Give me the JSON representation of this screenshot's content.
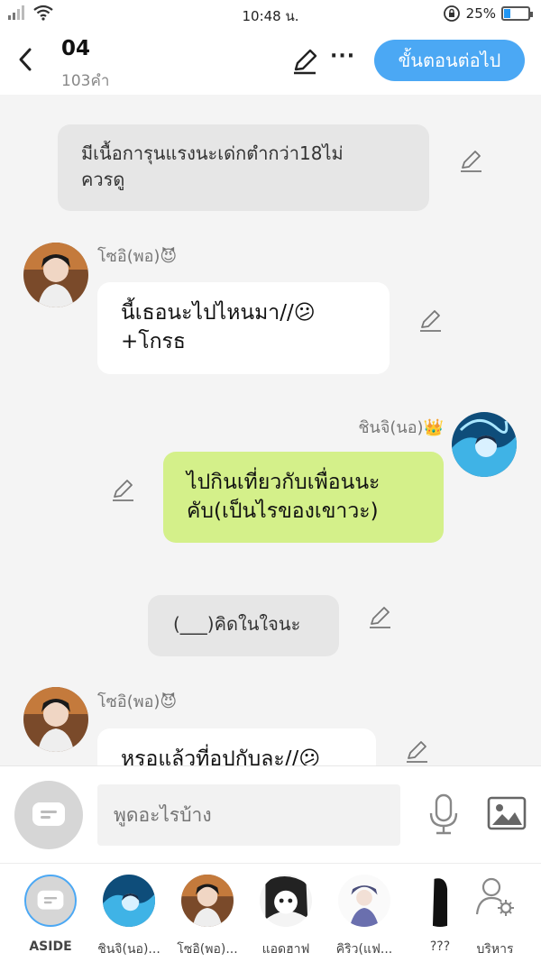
{
  "status": {
    "time": "10:48 น.",
    "battery": "25%",
    "battery_level": 0.25
  },
  "header": {
    "title": "04",
    "word_count": "103คำ",
    "more": "···",
    "next_button": "ขั้นตอนต่อไป"
  },
  "messages": [
    {
      "type": "narration",
      "text_line1": "มีเนื้อการุนแรงนะเด่กตำกว่า18ไม่",
      "text_line2": "ควรดู"
    },
    {
      "type": "left",
      "name": "โซอิ(พอ)",
      "name_emoji": "😈",
      "text_line1": "นี้เธอนะไปไหนมา//😕",
      "text_line2": "+โกรธ"
    },
    {
      "type": "right",
      "name": "ชินจิ(นอ)",
      "name_emoji": "👑",
      "text_line1": "ไปกินเที่ยวกับเพื่อนนะ",
      "text_line2": "คับ(เป็นไรของเขาวะ)"
    },
    {
      "type": "narration",
      "text_line1": "(___)คิดในใจนะ"
    },
    {
      "type": "left",
      "name": "โซอิ(พอ)",
      "name_emoji": "😈",
      "text_line1": "หรอแล้วที่อปกับละ//😕"
    }
  ],
  "input": {
    "placeholder": "พูดอะไรบ้าง"
  },
  "characters": [
    {
      "label": "ASIDE"
    },
    {
      "label": "ชินจิ(นอ)..."
    },
    {
      "label": "โซอิ(พอ)..."
    },
    {
      "label": "แอดฮาฟ"
    },
    {
      "label": "คิริว(แฟ..."
    },
    {
      "label": "???"
    },
    {
      "label": "บริหาร"
    }
  ],
  "colors": {
    "accent": "#4ba8f4",
    "bubble_right": "#d4f08a",
    "bubble_left": "#ffffff",
    "narration": "#e6e6e6"
  }
}
